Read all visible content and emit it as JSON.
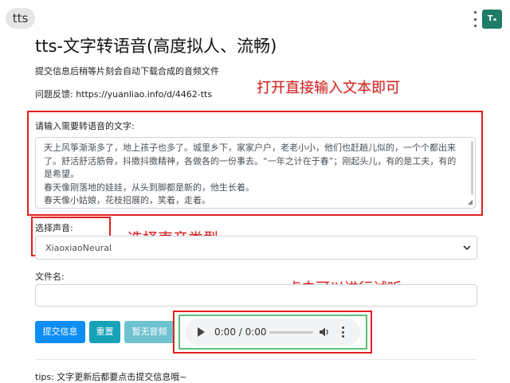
{
  "tab": {
    "label": "tts"
  },
  "extension": {
    "icon_text": "Tₐ"
  },
  "page": {
    "title": "tts-文字转语音(高度拟人、流畅)",
    "subtitle": "提交信息后稍等片刻会自动下载合成的音频文件",
    "feedback": "问题反馈: https://yuanliao.info/d/4462-tts"
  },
  "form": {
    "text_label": "请输入需要转语音的文字:",
    "text_lines": [
      "天上风筝渐渐多了，地上孩子也多了。城里乡下，家家户户，老老小小，他们也赶趟儿似的，一个个都出来",
      "了。舒活舒活筋骨，抖擞抖擞精神，各做各的一份事去。“一年之计在于春”；刚起头儿，有的是工夫，有的",
      "是希望。",
      "春天像刚落地的娃娃，从头到脚都是新的，他生长着。",
      "春天像小姑娘，花枝招展的，笑着，走着。"
    ],
    "voice_label": "选择声音:",
    "voice_value": "XiaoxiaoNeural",
    "filename_label": "文件名:",
    "filename_value": ""
  },
  "buttons": {
    "submit": "提交信息",
    "reset": "重置",
    "no_audio": "暂无音频"
  },
  "audio": {
    "time": "0:00 / 0:00",
    "progress": 0
  },
  "annotations": {
    "input_hint": "打开直接输入文本即可",
    "voice_hint": "选择声音类型",
    "play_hint": "点击可以进行试听"
  },
  "tips": "tips: 文字更新后都要点击提交信息哦~",
  "colors": {
    "primary": "#0d8ef5",
    "info": "#17a2b8",
    "disabled_info": "#6fc3d0",
    "annotation_red": "#e02020",
    "annotation_green": "#5bbf7a"
  }
}
